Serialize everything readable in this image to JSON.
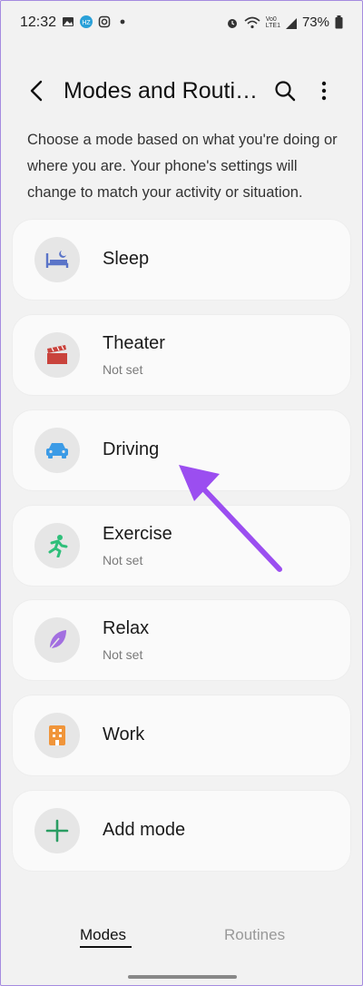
{
  "status": {
    "time": "12:32",
    "battery": "73%",
    "network": "LTE1",
    "network_top": "Vo0"
  },
  "header": {
    "title": "Modes and Routi…"
  },
  "description": "Choose a mode based on what you're doing or where you are. Your phone's settings will change to match your activity or situation.",
  "modes": [
    {
      "label": "Sleep",
      "sub": "",
      "icon": "bed-icon",
      "color": "#5a74c8"
    },
    {
      "label": "Theater",
      "sub": "Not set",
      "icon": "clapperboard-icon",
      "color": "#c9433c"
    },
    {
      "label": "Driving",
      "sub": "",
      "icon": "car-icon",
      "color": "#3c9be6"
    },
    {
      "label": "Exercise",
      "sub": "Not set",
      "icon": "runner-icon",
      "color": "#2fbf7a"
    },
    {
      "label": "Relax",
      "sub": "Not set",
      "icon": "leaf-icon",
      "color": "#a26fe0"
    },
    {
      "label": "Work",
      "sub": "",
      "icon": "building-icon",
      "color": "#f0953a"
    },
    {
      "label": "Add mode",
      "sub": "",
      "icon": "plus-icon",
      "color": "#2a9d63"
    }
  ],
  "tabs": {
    "modes": "Modes",
    "routines": "Routines"
  },
  "annotation": {
    "arrow_color": "#9b4ef0"
  }
}
